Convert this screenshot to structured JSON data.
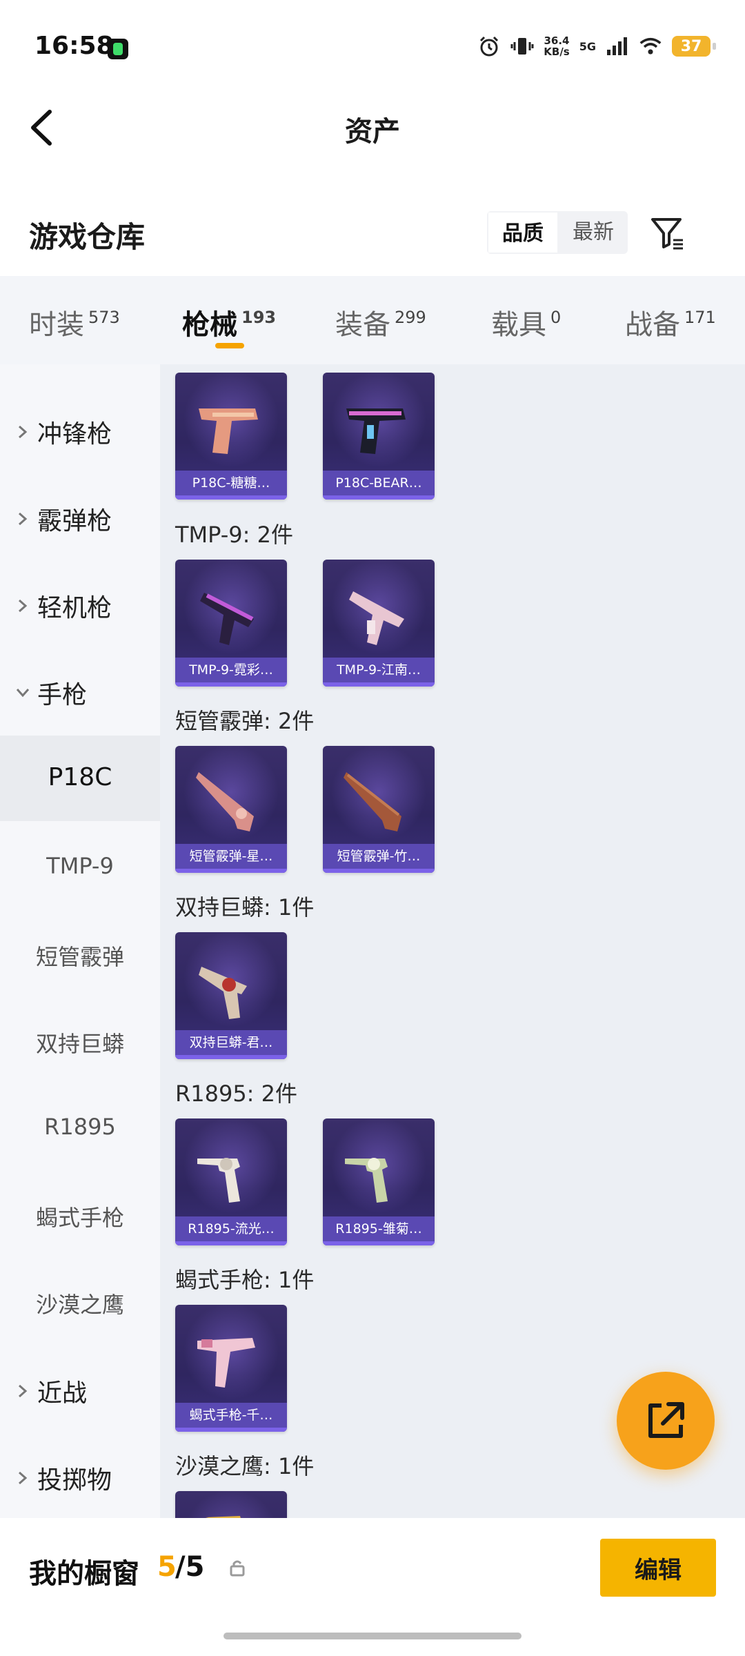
{
  "status_bar": {
    "time": "16:58",
    "net_speed": "36.4",
    "net_unit": "KB/s",
    "network": "5G",
    "battery": "37"
  },
  "header": {
    "title": "资产"
  },
  "section": {
    "title": "游戏仓库",
    "sort_options": [
      "品质",
      "最新"
    ],
    "active_sort": "品质"
  },
  "tabs": [
    {
      "label": "时装",
      "count": "573"
    },
    {
      "label": "枪械",
      "count": "193",
      "active": true
    },
    {
      "label": "装备",
      "count": "299"
    },
    {
      "label": "载具",
      "count": "0"
    },
    {
      "label": "战备",
      "count": "171"
    }
  ],
  "sidebar": {
    "groups": [
      "冲锋枪",
      "霰弹枪",
      "轻机枪",
      "手枪",
      "近战",
      "投掷物"
    ],
    "sub_items": [
      "P18C",
      "TMP-9",
      "短管霰弹",
      "双持巨蟒",
      "R1895",
      "蝎式手枪",
      "沙漠之鹰"
    ],
    "active_sub": "P18C"
  },
  "content": {
    "groups": [
      {
        "label": "",
        "items": [
          "P18C-糖糖…",
          "P18C-BEAR…"
        ]
      },
      {
        "label": "TMP-9: 2件",
        "items": [
          "TMP-9-霓彩…",
          "TMP-9-江南…"
        ]
      },
      {
        "label": "短管霰弹: 2件",
        "items": [
          "短管霰弹-星…",
          "短管霰弹-竹…"
        ]
      },
      {
        "label": "双持巨蟒: 1件",
        "items": [
          "双持巨蟒-君…"
        ]
      },
      {
        "label": "R1895: 2件",
        "items": [
          "R1895-流光…",
          "R1895-雏菊…"
        ]
      },
      {
        "label": "蝎式手枪: 1件",
        "items": [
          "蝎式手枪-千…"
        ]
      },
      {
        "label": "沙漠之鹰: 1件",
        "items": [
          ""
        ]
      }
    ]
  },
  "bottom_bar": {
    "label": "我的橱窗",
    "used": "5",
    "total": "/5",
    "edit": "编辑"
  },
  "colors": {
    "accent": "#f5a300",
    "card_bg": "#2f2660",
    "fab": "#f7a21b"
  }
}
